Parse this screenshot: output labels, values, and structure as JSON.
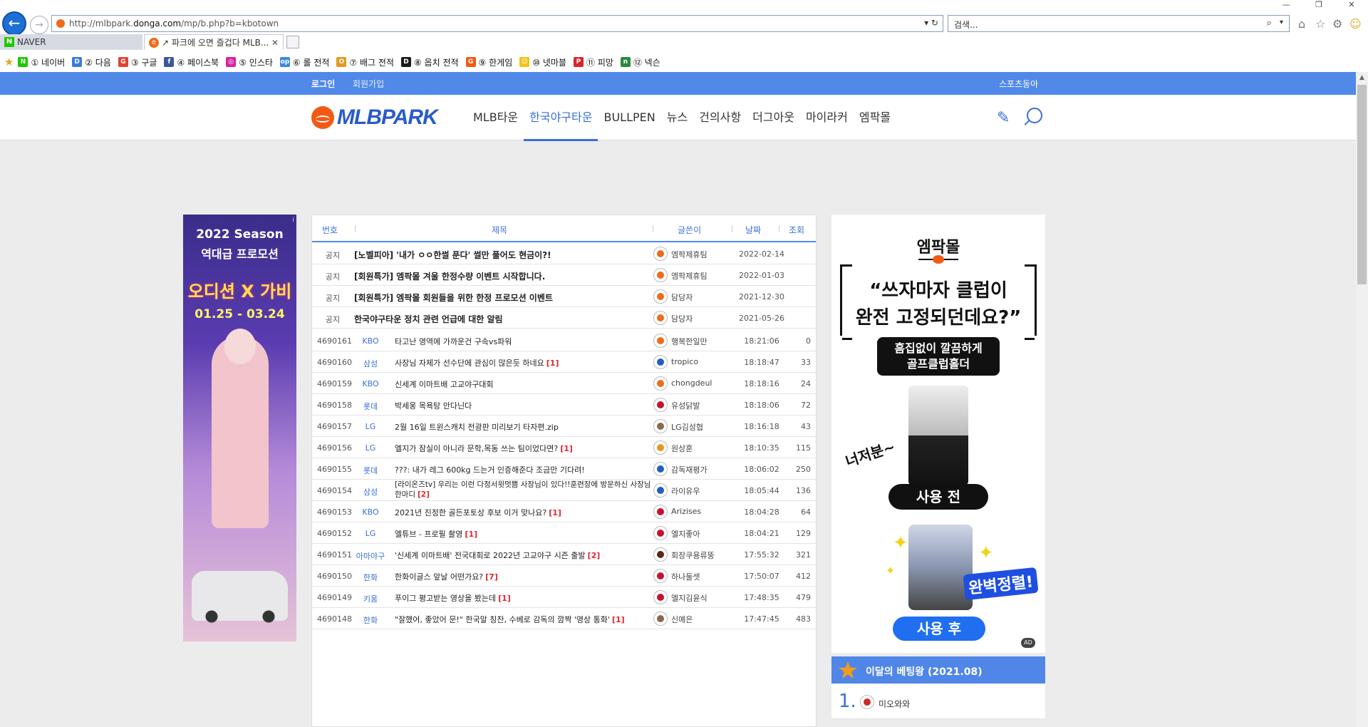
{
  "browser": {
    "window_controls": [
      "—",
      "❐",
      "✕"
    ],
    "url_prefix": "http://mlbpark.",
    "url_domain": "donga.com",
    "url_suffix": "/mp/b.php?b=kbotown",
    "address_tools": "▾ ↻",
    "search_placeholder": "검색...",
    "tabs": [
      {
        "label": "NAVER",
        "icon": "N"
      },
      {
        "label": "↗ 파크에 오면 즐겁다 MLB...",
        "icon": "e"
      }
    ],
    "favorites": [
      {
        "label": "① 네이버",
        "icon": "N",
        "color": "#1ec800"
      },
      {
        "label": "② 다음",
        "icon": "D",
        "color": "#3d7be0"
      },
      {
        "label": "③ 구글",
        "icon": "G",
        "color": "#e34133"
      },
      {
        "label": "④ 페이스북",
        "icon": "f",
        "color": "#3b5998"
      },
      {
        "label": "⑤ 인스타",
        "icon": "◎",
        "color": "#d6249f"
      },
      {
        "label": "⑥ 롤 전적",
        "icon": "op",
        "color": "#3a8ae0"
      },
      {
        "label": "⑦ 배그 전적",
        "icon": "O",
        "color": "#e39a1c"
      },
      {
        "label": "⑧ 옵치 전적",
        "icon": "D",
        "color": "#1a1a1a"
      },
      {
        "label": "⑨ 한게임",
        "icon": "G",
        "color": "#f25a13"
      },
      {
        "label": "⑩ 넷마블",
        "icon": "☺",
        "color": "#f2c21a"
      },
      {
        "label": "⑪ 피망",
        "icon": "P",
        "color": "#d8262e"
      },
      {
        "label": "⑫ 넥슨",
        "icon": "n",
        "color": "#2a8c3a"
      }
    ]
  },
  "topbar": {
    "login": "로그인",
    "join": "회원가입",
    "sports": "스포츠동아"
  },
  "nav": {
    "logo": "MLBPARK",
    "items": [
      "MLB타운",
      "한국야구타운",
      "BULLPEN",
      "뉴스",
      "건의사항",
      "더그아웃",
      "마이라커",
      "엠팍몰"
    ],
    "active": 1
  },
  "left_ad": {
    "season": "2022 Season",
    "promo": "역대급 프로모션",
    "brand": "오디션 X 가비",
    "dates": "01.25 - 03.24",
    "info": "i"
  },
  "board": {
    "headers": {
      "num": "번호",
      "title": "제목",
      "author": "글쓴이",
      "date": "날짜",
      "views": "조회"
    },
    "notices": [
      {
        "label": "공지",
        "title": "[노벨피아] '내가 ㅇㅇ한썰 푼다' 썰만 풀어도 현금이?!",
        "author": "엠팍제휴팀",
        "date": "2022-02-14"
      },
      {
        "label": "공지",
        "title": "[회원특가] 엠팍몰 겨울 한정수량 이벤트 시작합니다.",
        "author": "엠팍제휴팀",
        "date": "2022-01-03"
      },
      {
        "label": "공지",
        "title": "[회원특가] 엠팍몰 회원들을 위한 한정 프로모션 이벤트",
        "author": "담당자",
        "date": "2021-12-30"
      },
      {
        "label": "공지",
        "title": "한국야구타운 정치 관련 언급에 대한 알림",
        "author": "담당자",
        "date": "2021-05-26"
      }
    ],
    "posts": [
      {
        "num": "4690161",
        "cat": "KBO",
        "title": "타고난 영역에 가까운건 구속vs파워",
        "count": "",
        "author": "행복한일만",
        "date": "18:21:06",
        "views": "0",
        "color": "#f06a1a"
      },
      {
        "num": "4690160",
        "cat": "삼성",
        "title": "사장님 자체가 선수단에 관심이 많은듯 하네요",
        "count": "[1]",
        "author": "tropico",
        "date": "18:18:47",
        "views": "33",
        "color": "#1f5fbf"
      },
      {
        "num": "4690159",
        "cat": "KBO",
        "title": "신세계 이마트배 고교야구대회",
        "count": "",
        "author": "chongdeul",
        "date": "18:18:16",
        "views": "24",
        "color": "#f06a1a"
      },
      {
        "num": "4690158",
        "cat": "롯데",
        "title": "박세웅 목욕탕 안다닌다",
        "count": "",
        "author": "유성닭발",
        "date": "18:18:06",
        "views": "72",
        "color": "#c8102e"
      },
      {
        "num": "4690157",
        "cat": "LG",
        "title": "2월 16일 트윈스캐치 전광판 미리보기 타자편.zip",
        "count": "",
        "author": "LG김성협",
        "date": "18:16:18",
        "views": "43",
        "color": "#8a6a4a"
      },
      {
        "num": "4690156",
        "cat": "LG",
        "title": "엘지가 잠실이 아니라 문학,목동 쓰는 팀이었다면?",
        "count": "[1]",
        "author": "원상훈",
        "date": "18:10:35",
        "views": "115",
        "color": "#e39a1c"
      },
      {
        "num": "4690155",
        "cat": "롯데",
        "title": "???: 내가 레그 600kg 드는거 인증해준다 조금만 기다려!",
        "count": "",
        "author": "감독재평가",
        "date": "18:06:02",
        "views": "250",
        "color": "#1f5fbf"
      },
      {
        "num": "4690154",
        "cat": "삼성",
        "title": "[라이온즈tv] 우리는 이런 다정서윗멋쁨 사장님이 있다!!훈련장에 방문하신 사장님 한마디",
        "count": "[2]",
        "author": "라이유우",
        "date": "18:05:44",
        "views": "136",
        "color": "#1f5fbf",
        "two": true
      },
      {
        "num": "4690153",
        "cat": "KBO",
        "title": "2021년 진정한 골든포토상 후보 이거 맞나요?",
        "count": "[1]",
        "author": "Arizises",
        "date": "18:04:28",
        "views": "64",
        "color": "#c8102e"
      },
      {
        "num": "4690152",
        "cat": "LG",
        "title": "엘튜브 - 프로필 촬영",
        "count": "[1]",
        "author": "엘지좋아",
        "date": "18:04:21",
        "views": "129",
        "color": "#c8102e"
      },
      {
        "num": "4690151",
        "cat": "아마야구",
        "title": "'신세계 이마트배' 전국대회로 2022년 고교야구 시즌 출발",
        "count": "[2]",
        "author": "회장쿠용류뚱",
        "date": "17:55:32",
        "views": "321",
        "color": "#5a2a1a"
      },
      {
        "num": "4690150",
        "cat": "한화",
        "title": "한화이글스 앞날 어떤가요?",
        "count": "[7]",
        "author": "하나둘셋",
        "date": "17:50:07",
        "views": "412",
        "color": "#c8102e"
      },
      {
        "num": "4690149",
        "cat": "키움",
        "title": "푸이그 평고받는 영상을 봤는데",
        "count": "[1]",
        "author": "엘지김윤식",
        "date": "17:48:35",
        "views": "479",
        "color": "#c8102e"
      },
      {
        "num": "4690148",
        "cat": "한화",
        "title": "\"잘했어, 좋았어 문!\" 한국말 칭찬, 수베로 감독의 깜짝 '영상 통화'",
        "count": "[1]",
        "author": "신예은",
        "date": "17:47:45",
        "views": "483",
        "color": "#8a6a4a"
      }
    ]
  },
  "right_ad": {
    "mall": "엠팍몰",
    "quote1": "“쓰자마자 클럽이",
    "quote2": "완전 고정되던데요?”",
    "pill1": "흠집없이 깔끔하게",
    "pill2": "골프클럽홀더",
    "messy": "너저분~",
    "before": "사용 전",
    "perfect": "완벽정렬!",
    "after": "사용 후",
    "ad": "AD"
  },
  "ranking": {
    "title": "이달의 베팅왕 (2021.08)",
    "first_rank": "1.",
    "first_name": "미오와와"
  }
}
